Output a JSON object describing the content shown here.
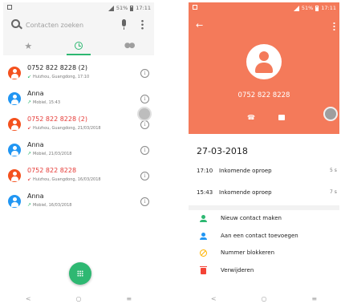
{
  "left_phone": {
    "status": {
      "signal_text": "✱",
      "battery": "51%",
      "time": "17:11"
    },
    "search": {
      "placeholder": "Contacten zoeken"
    },
    "calls": [
      {
        "name": "0752 822 8228 (2)",
        "detail": "Huizhou, Guangdong, 17:10",
        "missed": false,
        "avatar_color": "#f4511e",
        "direction": "incoming"
      },
      {
        "name": "Anna",
        "detail": "Mobiel, 15:43",
        "missed": false,
        "avatar_color": "#2196f3",
        "direction": "outgoing"
      },
      {
        "name": "0752 822 8228 (2)",
        "detail": "Huizhou, Guangdong, 21/03/2018",
        "missed": true,
        "avatar_color": "#f4511e",
        "direction": "missed"
      },
      {
        "name": "Anna",
        "detail": "Mobiel, 21/03/2018",
        "missed": false,
        "avatar_color": "#2196f3",
        "direction": "outgoing"
      },
      {
        "name": "0752 822 8228",
        "detail": "Huizhou, Guangdong, 16/03/2018",
        "missed": true,
        "avatar_color": "#f4511e",
        "direction": "missed"
      },
      {
        "name": "Anna",
        "detail": "Mobiel, 16/03/2018",
        "missed": false,
        "avatar_color": "#2196f3",
        "direction": "outgoing"
      }
    ],
    "nav": {
      "back": "<",
      "home": "○",
      "recents": "≡"
    }
  },
  "right_phone": {
    "status": {
      "battery": "51%",
      "time": "17:11"
    },
    "hero_number": "0752 822 8228",
    "date": "27-03-2018",
    "log": [
      {
        "time": "17:10",
        "type": "Inkomende oproep",
        "duration": "5 s"
      },
      {
        "time": "15:43",
        "type": "Inkomende oproep",
        "duration": "7 s"
      }
    ],
    "actions": [
      {
        "label": "Nieuw contact maken"
      },
      {
        "label": "Aan een contact toevoegen"
      },
      {
        "label": "Nummer blokkeren"
      },
      {
        "label": "Verwijderen"
      }
    ],
    "nav": {
      "back": "<",
      "home": "○",
      "recents": "≡"
    }
  },
  "colors": {
    "accent_green": "#2eb872",
    "hero_orange": "#f47a5a",
    "missed_red": "#e53935",
    "contact_blue": "#2196f3"
  },
  "icons": [
    "search-icon",
    "mic-icon",
    "more-icon",
    "star-icon",
    "clock-icon",
    "people-icon",
    "info-icon",
    "dialpad-icon",
    "back-icon",
    "phone-icon",
    "message-icon",
    "person-add-icon",
    "block-icon",
    "trash-icon"
  ]
}
